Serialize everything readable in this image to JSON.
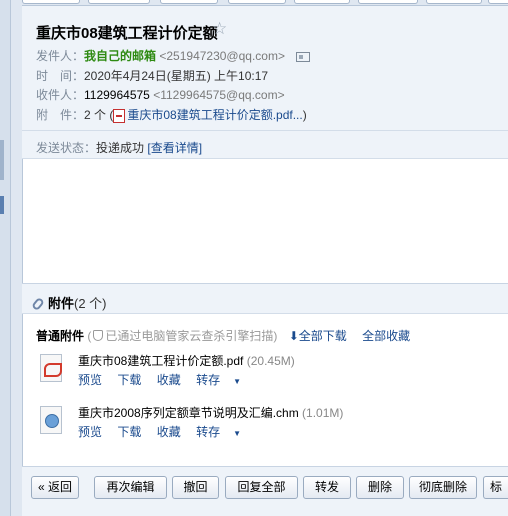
{
  "email": {
    "subject": "重庆市08建筑工程计价定额",
    "sender_label": "发件人：",
    "sender_name": "我自己的邮箱",
    "sender_email": "<251947230@qq.com>",
    "time_label": "时　间：",
    "time_value": "2020年4月24日(星期五) 上午10:17",
    "recipient_label": "收件人：",
    "recipient_name": "1129964575",
    "recipient_email": "<1129964575@qq.com>",
    "attach_label": "附　件：",
    "attach_summary_count": "2 个 (",
    "attach_summary_link": "重庆市08建筑工程计价定额.pdf...",
    "attach_summary_close": ")",
    "status_label": "发送状态：",
    "status_value": "投递成功",
    "status_link": "[查看详情]"
  },
  "attachments": {
    "heading": "附件",
    "count": "(2 个)",
    "section_label": "普通附件",
    "scan_note": "已通过电脑管家云查杀引擎扫描",
    "download_all": "全部下载",
    "save_all": "全部收藏",
    "files": [
      {
        "name": "重庆市08建筑工程计价定额.pdf",
        "size": "(20.45M)",
        "icon": "pdf-file-icon",
        "actions": [
          "预览",
          "下载",
          "收藏",
          "转存"
        ]
      },
      {
        "name": "重庆市2008序列定额章节说明及汇编.chm",
        "size": "(1.01M)",
        "icon": "chm-file-icon",
        "actions": [
          "预览",
          "下载",
          "收藏",
          "转存"
        ]
      }
    ]
  },
  "toolbar": {
    "back": "« 返回",
    "edit_again": "再次编辑",
    "recall": "撤回",
    "reply_all": "回复全部",
    "forward": "转发",
    "delete": "删除",
    "delete_permanently": "彻底删除",
    "mark": "标"
  },
  "colors": {
    "header_bg": "#eef3f9",
    "link": "#1a4a8d",
    "sender_green": "#2e8a12"
  }
}
